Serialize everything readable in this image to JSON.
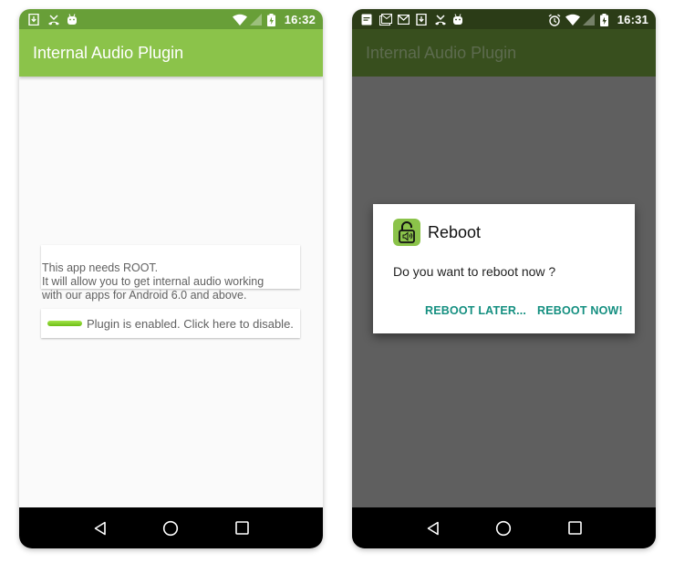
{
  "screens": [
    {
      "status_bar": {
        "left_icons": [
          "download-icon",
          "missed-call-icon",
          "android-icon"
        ],
        "right_icons": [
          "wifi-icon",
          "cell-signal-icon",
          "battery-charging-icon"
        ],
        "time": "16:32"
      },
      "app_bar": {
        "title": "Internal Audio Plugin"
      },
      "info_card": {
        "text": "This app needs ROOT.\n It will allow you to get internal audio working\nwith our apps for Android 6.0 and above."
      },
      "toggle_card": {
        "label": "Plugin is enabled. Click here to disable.",
        "enabled": true
      },
      "nav_bar": {
        "buttons": [
          "back",
          "home",
          "recents"
        ]
      },
      "colors": {
        "status_bar": "#689f38",
        "app_bar": "#8bc34a",
        "toggle": "#7ed321"
      }
    },
    {
      "status_bar": {
        "left_icons": [
          "notes-icon",
          "gmail-stack-icon",
          "gmail-icon",
          "download-icon",
          "missed-call-icon",
          "android-icon"
        ],
        "right_icons": [
          "alarm-icon",
          "wifi-icon",
          "cell-signal-icon",
          "battery-charging-icon"
        ],
        "time": "16:31"
      },
      "app_bar": {
        "title": "Internal Audio Plugin"
      },
      "dialog": {
        "title": "Reboot",
        "icon": "lock-speaker-icon",
        "message": "Do you want to reboot now ?",
        "buttons": {
          "negative": "REBOOT LATER...",
          "positive": "REBOOT NOW!"
        }
      },
      "nav_bar": {
        "buttons": [
          "back",
          "home",
          "recents"
        ]
      },
      "colors": {
        "dialog_button": "#148f80",
        "scrim": "#5f5f5f"
      }
    }
  ]
}
